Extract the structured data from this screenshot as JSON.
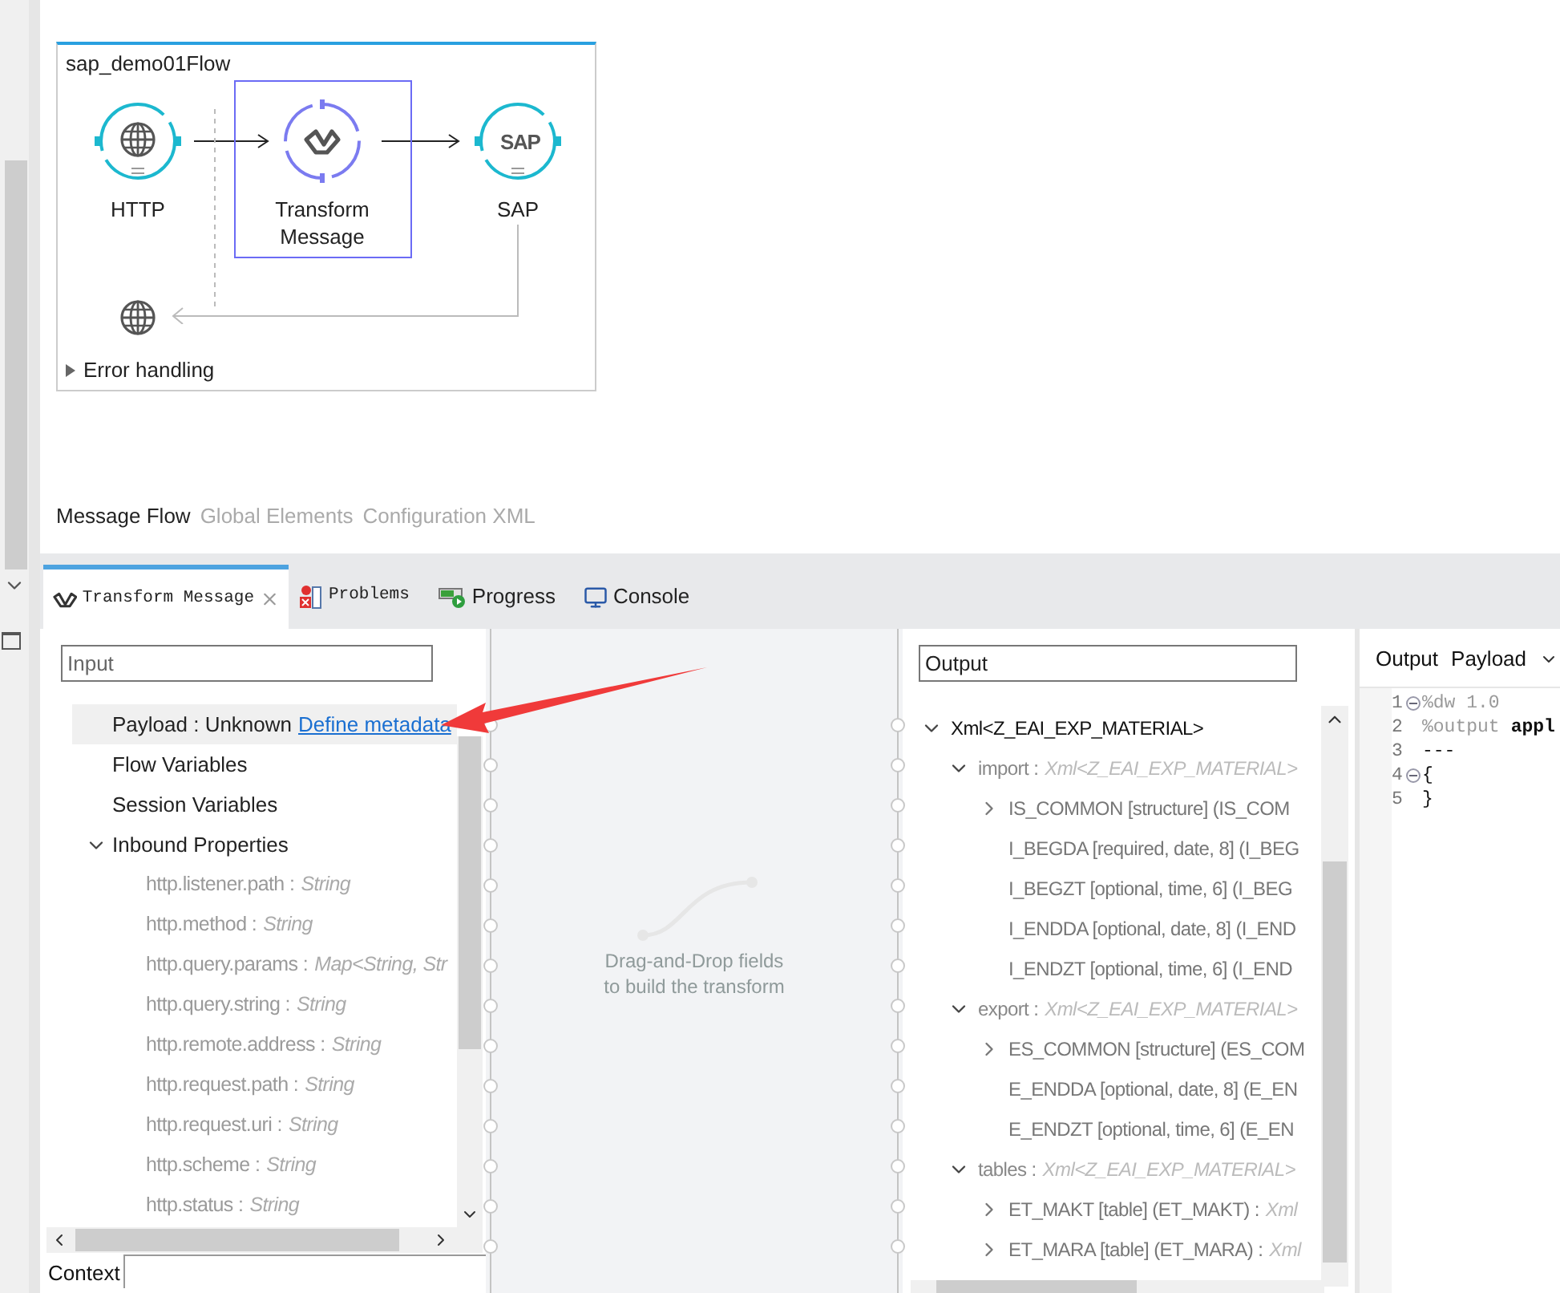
{
  "flow": {
    "title": "sap_demo01Flow",
    "nodes": [
      {
        "label": "HTTP",
        "kind": "http",
        "selected": false
      },
      {
        "label": "Transform Message",
        "kind": "transform",
        "selected": true
      },
      {
        "label": "SAP",
        "kind": "sap",
        "logo": "SAP",
        "selected": false
      }
    ],
    "error_handling": {
      "label": "Error handling",
      "expanded": false
    }
  },
  "editor_tabs": [
    {
      "label": "Message Flow",
      "selected": true
    },
    {
      "label": "Global Elements",
      "selected": false
    },
    {
      "label": "Configuration XML",
      "selected": false
    }
  ],
  "panel_tabs": [
    {
      "label": "Transform Message",
      "kind": "transform",
      "selected": true,
      "closable": true
    },
    {
      "label": "Problems",
      "kind": "problems",
      "selected": false,
      "closable": false
    },
    {
      "label": "Progress",
      "kind": "progress",
      "selected": false,
      "closable": false
    },
    {
      "label": "Console",
      "kind": "console",
      "selected": false,
      "closable": false
    }
  ],
  "input": {
    "placeholder": "Input",
    "tree": [
      {
        "name": "Payload : Unknown",
        "link": "Define metadata",
        "selected": true
      },
      {
        "name": "Flow Variables",
        "selected": false
      },
      {
        "name": "Session Variables",
        "selected": false
      },
      {
        "name": "Inbound Properties",
        "selected": false,
        "expanded": true,
        "children": [
          {
            "name": "http.listener.path :",
            "type": "String",
            "selected": false
          },
          {
            "name": "http.method :",
            "type": "String",
            "selected": false
          },
          {
            "name": "http.query.params :",
            "type": "Map<String, Str",
            "selected": false
          },
          {
            "name": "http.query.string :",
            "type": "String",
            "selected": false
          },
          {
            "name": "http.remote.address :",
            "type": "String",
            "selected": false
          },
          {
            "name": "http.request.path :",
            "type": "String",
            "selected": false
          },
          {
            "name": "http.request.uri :",
            "type": "String",
            "selected": false
          },
          {
            "name": "http.scheme :",
            "type": "String",
            "selected": false
          },
          {
            "name": "http.status :",
            "type": "String",
            "selected": false
          }
        ]
      }
    ],
    "context_label": "Context"
  },
  "mapping": {
    "hint": "Drag-and-Drop fields\nto build the transform"
  },
  "output": {
    "placeholder": "Output",
    "tree": [
      {
        "name": "Xml<Z_EAI_EXP_MATERIAL>",
        "expanded": true,
        "children": [
          {
            "name": "import :",
            "type": "Xml<Z_EAI_EXP_MATERIAL>",
            "expanded": true,
            "children": [
              {
                "name": "IS_COMMON [structure] (IS_COM",
                "expanded": false
              },
              {
                "name": "I_BEGDA [required, date, 8] (I_BEG"
              },
              {
                "name": "I_BEGZT [optional, time, 6] (I_BEG"
              },
              {
                "name": "I_ENDDA [optional, date, 8] (I_END"
              },
              {
                "name": "I_ENDZT [optional, time, 6] (I_END"
              }
            ]
          },
          {
            "name": "export :",
            "type": "Xml<Z_EAI_EXP_MATERIAL>",
            "expanded": true,
            "children": [
              {
                "name": "ES_COMMON [structure] (ES_COM",
                "expanded": false
              },
              {
                "name": "E_ENDDA [optional, date, 8] (E_EN"
              },
              {
                "name": "E_ENDZT [optional, time, 6] (E_EN"
              }
            ]
          },
          {
            "name": "tables :",
            "type": "Xml<Z_EAI_EXP_MATERIAL>",
            "expanded": true,
            "children": [
              {
                "name": "ET_MAKT [table] (ET_MAKT) :",
                "type": "Xml",
                "expanded": false
              },
              {
                "name": "ET_MARA [table] (ET_MARA) :",
                "type": "Xml",
                "expanded": false
              }
            ]
          }
        ]
      }
    ]
  },
  "script": {
    "header": [
      "Output",
      "Payload"
    ],
    "lines": [
      {
        "number": "1",
        "fold": true,
        "parts": [
          {
            "text": "%dw 1.0",
            "kind": "directive"
          }
        ]
      },
      {
        "number": "2",
        "fold": false,
        "parts": [
          {
            "text": "%output",
            "kind": "directive"
          },
          {
            "text": "appl",
            "kind": "keyword"
          }
        ]
      },
      {
        "number": "3",
        "fold": false,
        "parts": [
          {
            "text": "---",
            "kind": "plain"
          }
        ]
      },
      {
        "number": "4",
        "fold": true,
        "parts": [
          {
            "text": "{",
            "kind": "plain"
          }
        ]
      },
      {
        "number": "5",
        "fold": false,
        "parts": [
          {
            "text": "}",
            "kind": "plain"
          }
        ]
      }
    ]
  }
}
